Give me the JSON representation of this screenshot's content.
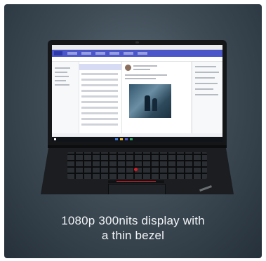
{
  "caption": {
    "line1": "1080p 300nits display with",
    "line2": "a thin bezel"
  },
  "colors": {
    "background_center": "#5e6e7a",
    "background_edge": "#25303a",
    "laptop_body": "#1b1d20",
    "trackpoint": "#d0202a",
    "app_accent": "#4b57c8",
    "caption_text": "#f2f4f6"
  }
}
